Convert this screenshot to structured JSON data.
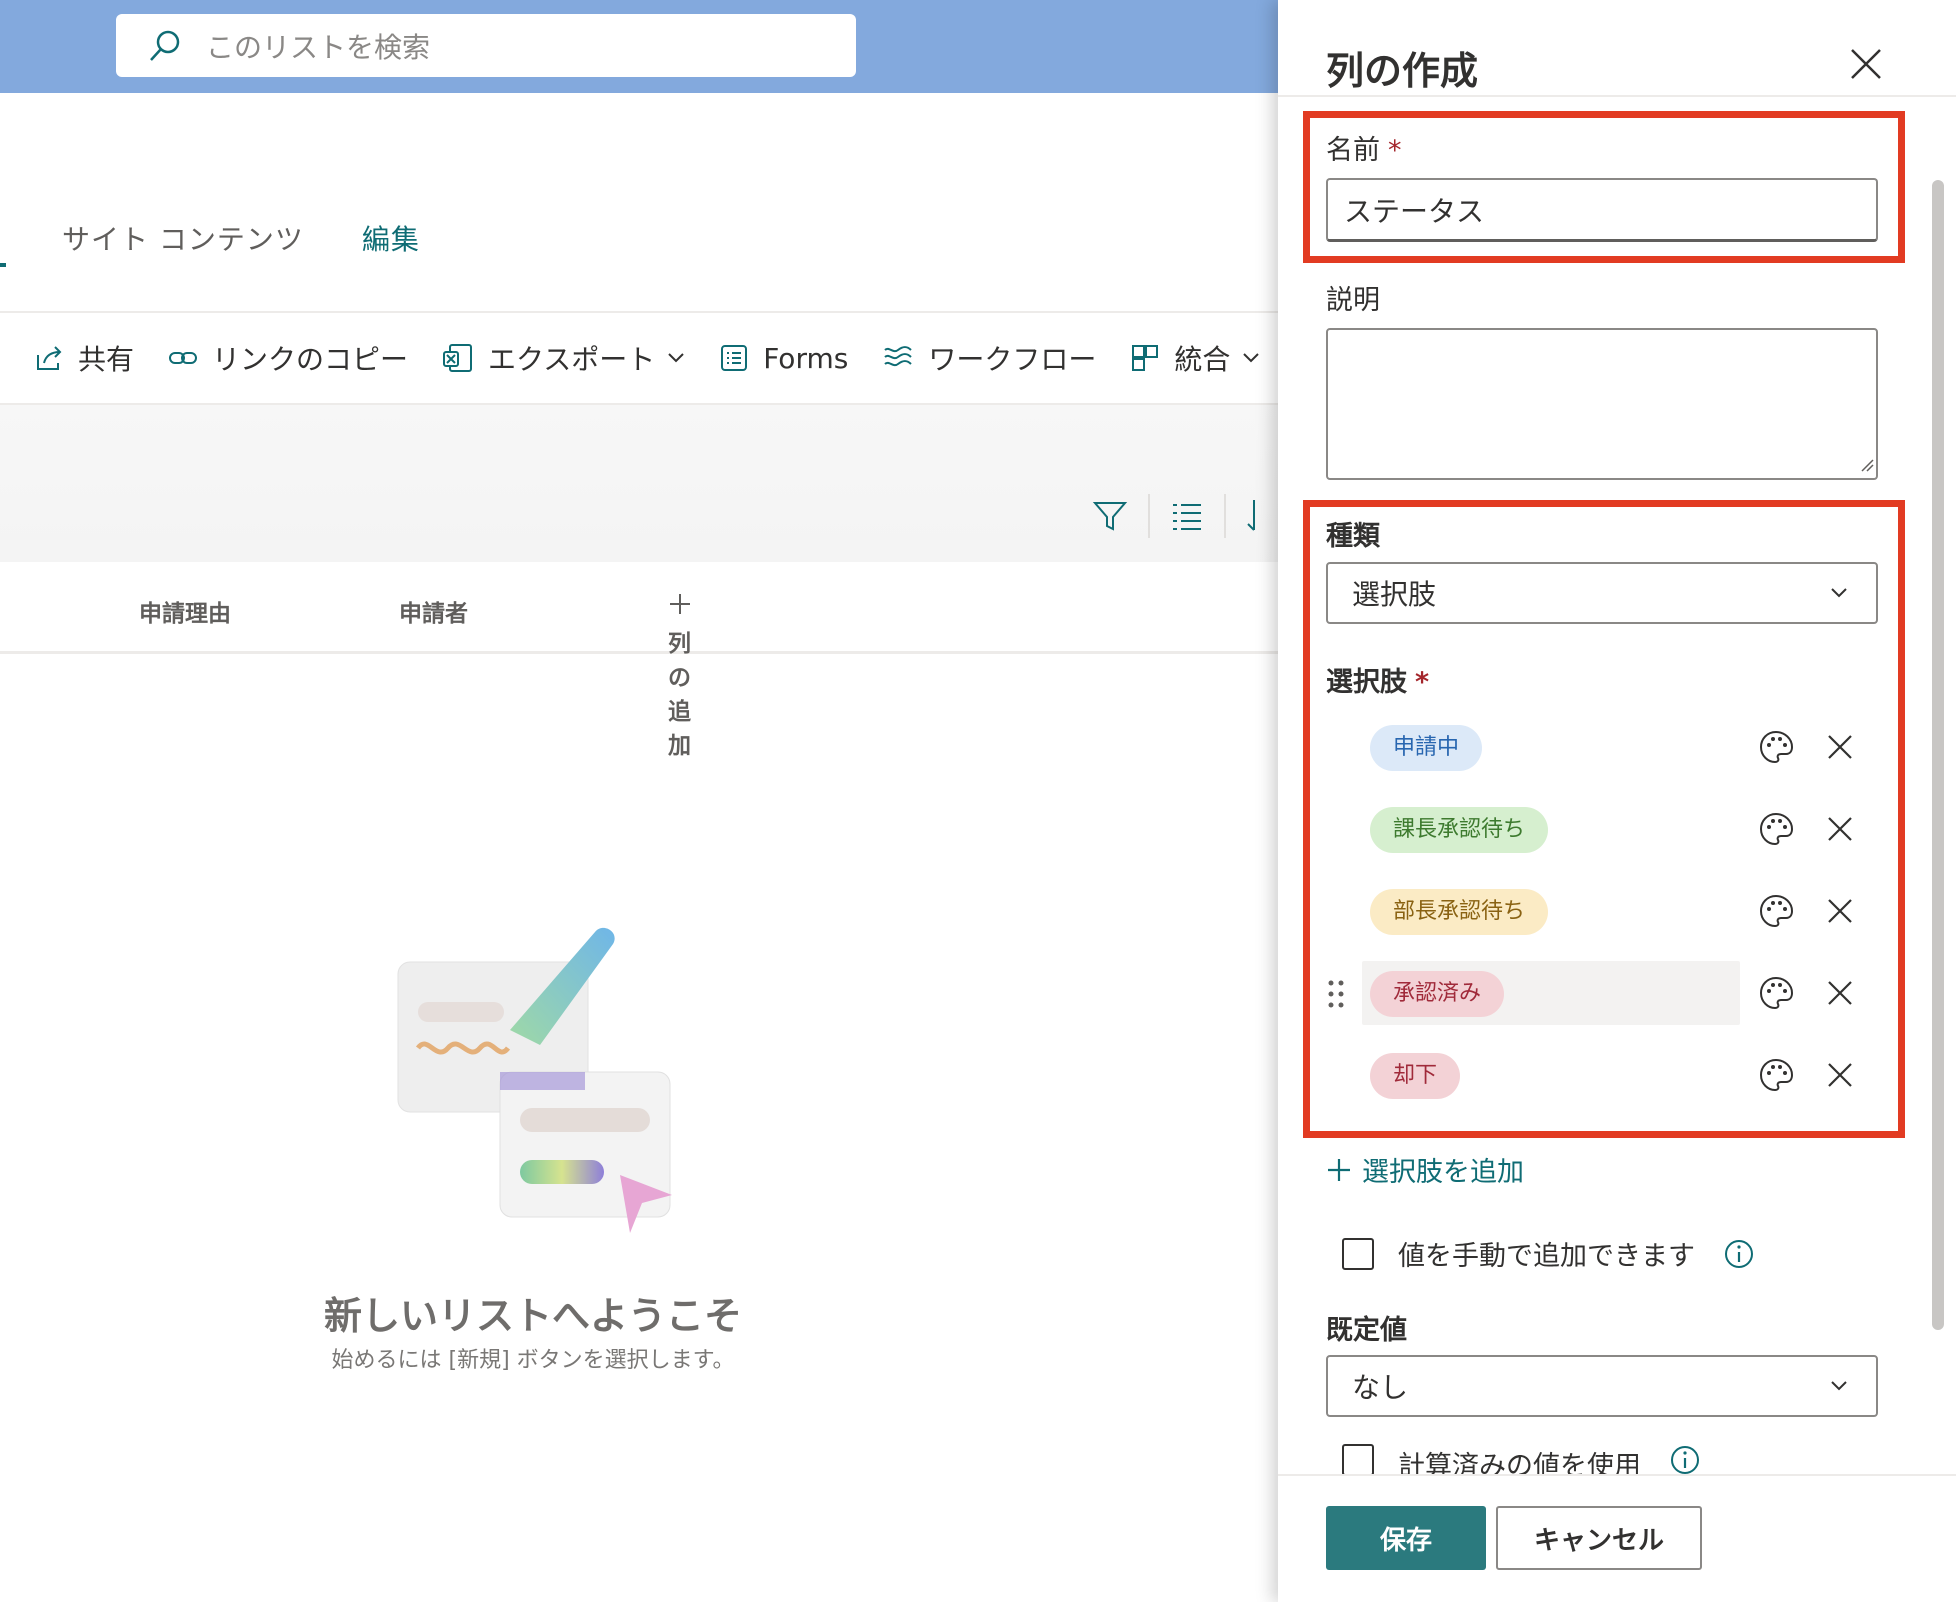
{
  "search": {
    "placeholder": "このリストを検索"
  },
  "nav": {
    "site_contents": "サイト コンテンツ",
    "edit": "編集"
  },
  "commands": [
    {
      "label": "共有",
      "icon": "share-icon"
    },
    {
      "label": "リンクのコピー",
      "icon": "link-icon"
    },
    {
      "label": "エクスポート",
      "icon": "excel-icon",
      "has_menu": true
    },
    {
      "label": "Forms",
      "icon": "forms-icon"
    },
    {
      "label": "ワークフロー",
      "icon": "workflow-icon"
    },
    {
      "label": "統合",
      "icon": "integrate-icon",
      "has_menu": true
    }
  ],
  "columns": {
    "reason": "申請理由",
    "applicant": "申請者",
    "add_column": "列の追加"
  },
  "empty_state": {
    "title": "新しいリストへようこそ",
    "subtitle": "始めるには [新規] ボタンを選択します。"
  },
  "panel": {
    "title": "列の作成",
    "name_label": "名前",
    "required_mark": "*",
    "name_value": "ステータス",
    "description_label": "説明",
    "description_value": "",
    "type_label": "種類",
    "type_value": "選択肢",
    "choices_label": "選択肢",
    "choices": [
      {
        "label": "申請中",
        "bg": "#dce9f8",
        "fg": "#2866b0"
      },
      {
        "label": "課長承認待ち",
        "bg": "#d6efcf",
        "fg": "#3d7a2e"
      },
      {
        "label": "部長承認待ち",
        "bg": "#fbebc5",
        "fg": "#8a6212"
      },
      {
        "label": "承認済み",
        "bg": "#f3d2d6",
        "fg": "#a02a3a"
      },
      {
        "label": "却下",
        "bg": "#f3d2d6",
        "fg": "#a02a3a"
      }
    ],
    "add_choice": "選択肢を追加",
    "manual_values": "値を手動で追加できます",
    "default_label": "既定値",
    "default_value": "なし",
    "calculated": "計算済みの値を使用",
    "save": "保存",
    "cancel": "キャンセル"
  },
  "colors": {
    "accent": "#0f6c74",
    "highlight": "#e23b22",
    "header_bg": "#83a9dd"
  }
}
